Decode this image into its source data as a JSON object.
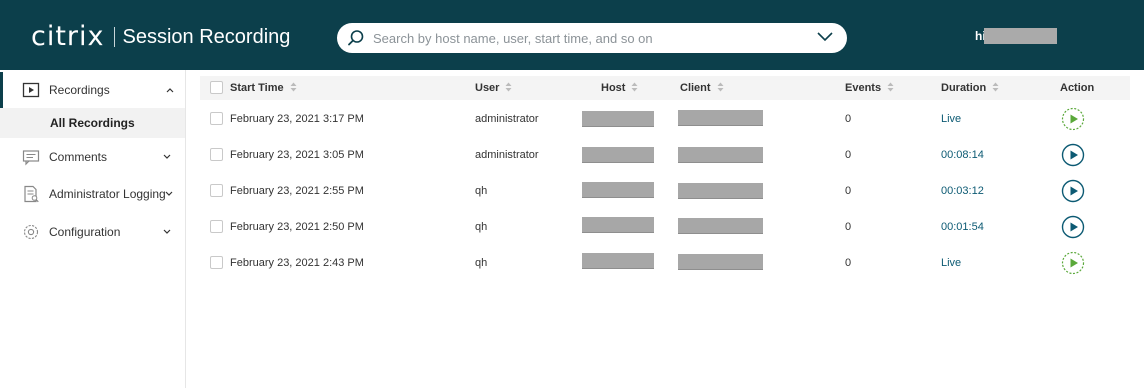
{
  "header": {
    "logo": "citrix",
    "product_title": "Session Recording",
    "search": {
      "placeholder": "Search by host name, user, start time, and so on",
      "value": ""
    },
    "user_greeting": "hi",
    "colors": {
      "header_bg": "#0c3f4b",
      "accent": "#0c5a73",
      "live_green": "#5aa83a"
    }
  },
  "sidebar": {
    "items": [
      {
        "label": "Recordings",
        "icon": "play-box-icon",
        "expanded": true
      },
      {
        "label": "Comments",
        "icon": "comment-icon",
        "expanded": false
      },
      {
        "label": "Administrator Logging",
        "icon": "log-document-icon",
        "expanded": false
      },
      {
        "label": "Configuration",
        "icon": "gear-icon",
        "expanded": false
      }
    ],
    "sub_item": {
      "label": "All Recordings",
      "selected": true
    }
  },
  "table": {
    "columns": {
      "start_time": "Start Time",
      "user": "User",
      "host": "Host",
      "client": "Client",
      "events": "Events",
      "duration": "Duration",
      "action": "Action"
    },
    "rows": [
      {
        "start_time": "February 23, 2021 3:17 PM",
        "user": "administrator",
        "events": "0",
        "duration": "Live",
        "live": true
      },
      {
        "start_time": "February 23, 2021 3:05 PM",
        "user": "administrator",
        "events": "0",
        "duration": "00:08:14",
        "live": false
      },
      {
        "start_time": "February 23, 2021 2:55 PM",
        "user": "qh",
        "events": "0",
        "duration": "00:03:12",
        "live": false
      },
      {
        "start_time": "February 23, 2021 2:50 PM",
        "user": "qh",
        "events": "0",
        "duration": "00:01:54",
        "live": false
      },
      {
        "start_time": "February 23, 2021 2:43 PM",
        "user": "qh",
        "events": "0",
        "duration": "Live",
        "live": true
      }
    ]
  }
}
